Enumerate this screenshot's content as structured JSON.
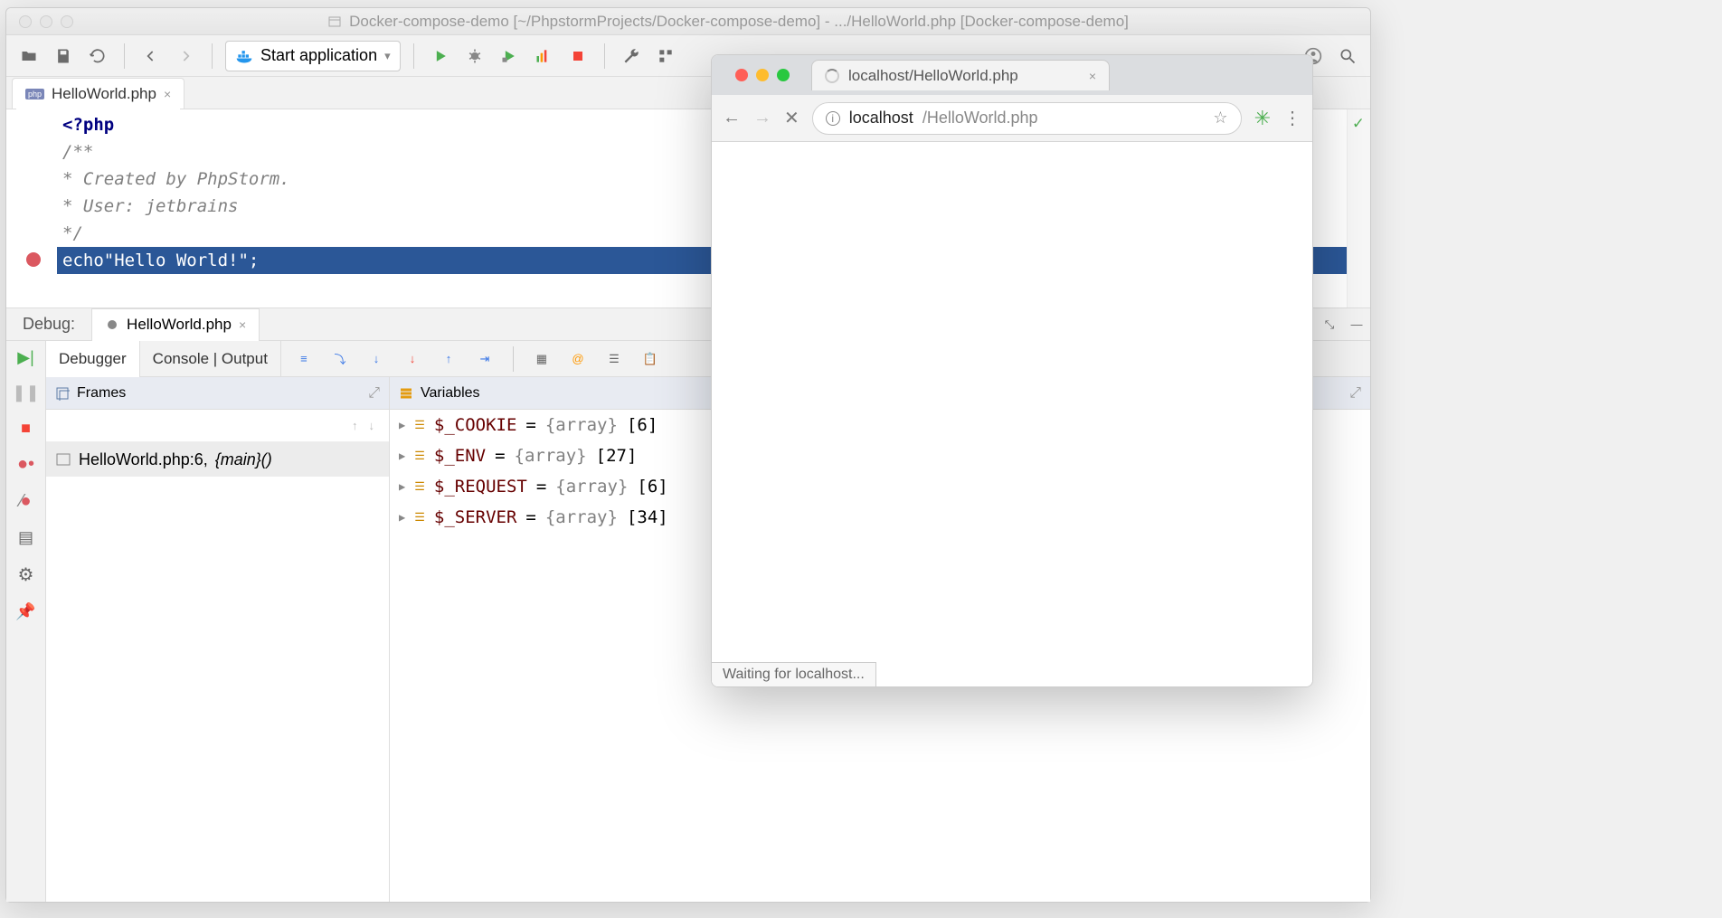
{
  "ide": {
    "title": "Docker-compose-demo [~/PhpstormProjects/Docker-compose-demo] - .../HelloWorld.php [Docker-compose-demo]",
    "runConfig": "Start application",
    "tab": {
      "label": "HelloWorld.php",
      "badge": "php"
    },
    "code": {
      "l1": "<?php",
      "l2": "/**",
      "l3": " * Created by PhpStorm.",
      "l4": " * User: jetbrains",
      "l5": " */",
      "l6a": "echo ",
      "l6b": "\"Hello World!\"",
      "l6c": ";"
    },
    "debug": {
      "label": "Debug:",
      "tab": "HelloWorld.php",
      "subtabs": {
        "debugger": "Debugger",
        "console": "Console | Output"
      },
      "frames": {
        "title": "Frames",
        "row": "HelloWorld.php:6, ",
        "fn": "{main}()"
      },
      "vars": {
        "title": "Variables",
        "items": [
          {
            "name": "$_COOKIE",
            "type": "{array}",
            "count": "[6]"
          },
          {
            "name": "$_ENV",
            "type": "{array}",
            "count": "[27]"
          },
          {
            "name": "$_REQUEST",
            "type": "{array}",
            "count": "[6]"
          },
          {
            "name": "$_SERVER",
            "type": "{array}",
            "count": "[34]"
          }
        ]
      }
    }
  },
  "browser": {
    "tab": "localhost/HelloWorld.php",
    "url_host": "localhost",
    "url_path": "/HelloWorld.php",
    "status": "Waiting for localhost..."
  }
}
